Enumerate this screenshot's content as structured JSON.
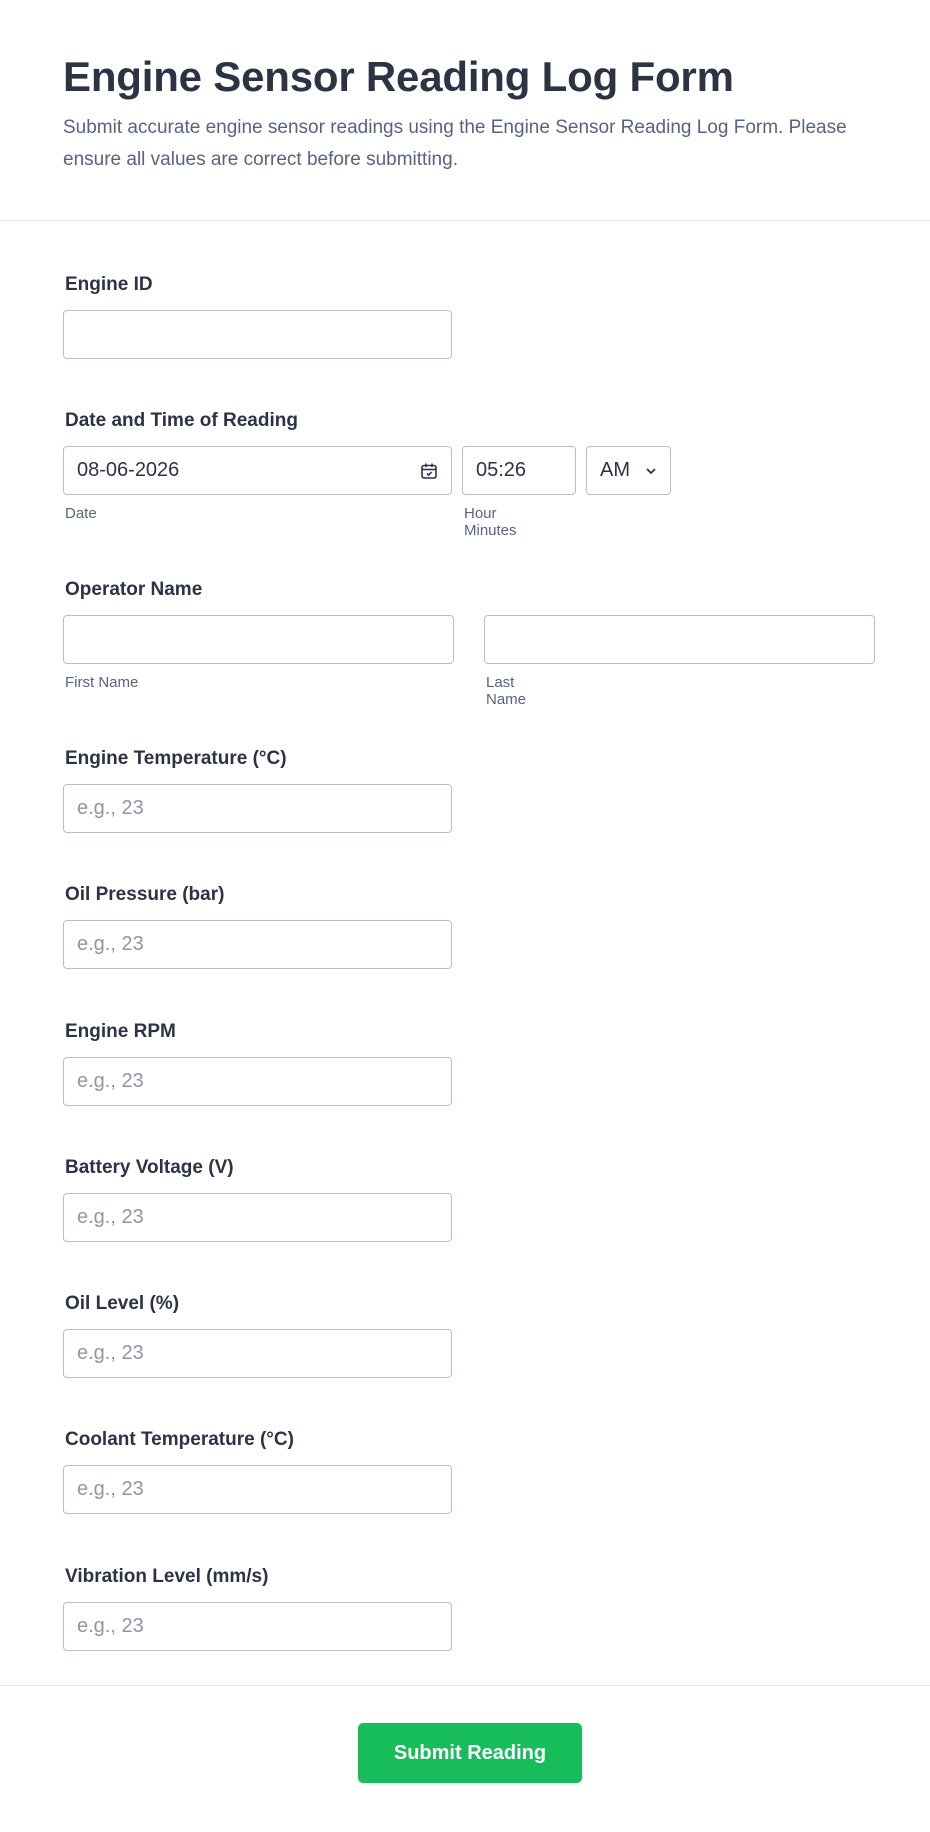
{
  "header": {
    "title": "Engine Sensor Reading Log Form",
    "subtitle": "Submit accurate engine sensor readings using the Engine Sensor Reading Log Form. Please ensure all values are correct before submitting."
  },
  "fields": {
    "engine_id": {
      "label": "Engine ID",
      "value": ""
    },
    "datetime": {
      "label": "Date and Time of Reading",
      "date_value": "08-06-2026",
      "time_value": "05:26",
      "ampm": "AM",
      "date_sublabel": "Date",
      "time_sublabel": "Hour Minutes"
    },
    "operator": {
      "label": "Operator Name",
      "first_sublabel": "First Name",
      "last_sublabel": "Last Name"
    },
    "engine_temperature": {
      "label": "Engine Temperature (°C)",
      "placeholder": "e.g., 23"
    },
    "oil_pressure": {
      "label": "Oil Pressure (bar)",
      "placeholder": "e.g., 23"
    },
    "engine_rpm": {
      "label": "Engine RPM",
      "placeholder": "e.g., 23"
    },
    "battery_voltage": {
      "label": "Battery Voltage (V)",
      "placeholder": "e.g., 23"
    },
    "oil_level": {
      "label": "Oil Level (%)",
      "placeholder": "e.g., 23"
    },
    "coolant_temperature": {
      "label": "Coolant Temperature (°C)",
      "placeholder": "e.g., 23"
    },
    "vibration_level": {
      "label": "Vibration Level (mm/s)",
      "placeholder": "e.g., 23"
    }
  },
  "footer": {
    "submit_label": "Submit Reading"
  },
  "icons": {
    "date_picker": "calendar-icon",
    "dropdown": "chevron-down-icon"
  },
  "colors": {
    "accent": "#18bd5b",
    "text": "#2c3345",
    "muted": "#57647e",
    "border": "#b8bdc9"
  }
}
